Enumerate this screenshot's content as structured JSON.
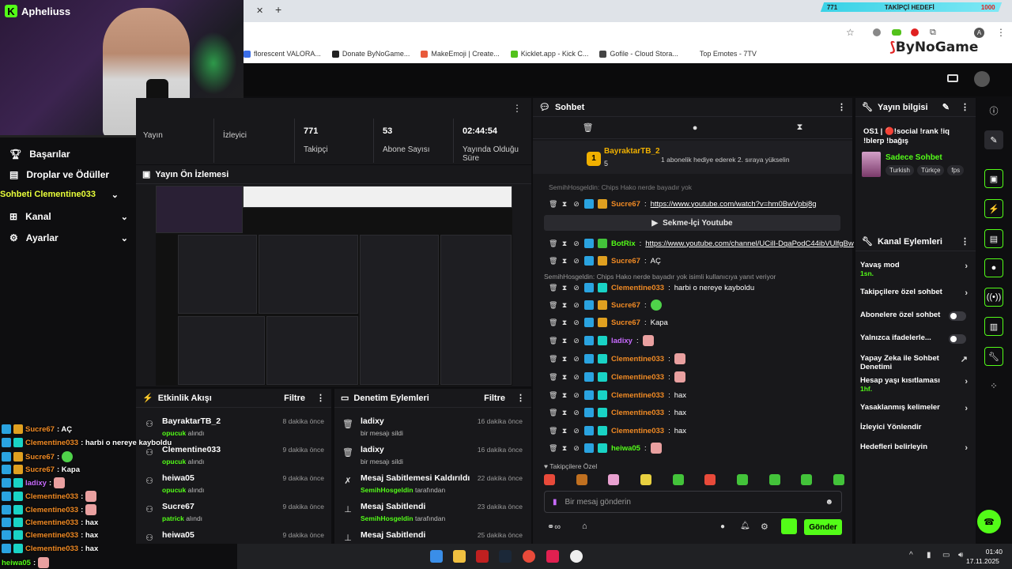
{
  "browser": {
    "close_tab": "✕",
    "new_tab": "+",
    "bookmarks": [
      {
        "label": "florescent VALORA...",
        "color": "#3b6ee8"
      },
      {
        "label": "Donate ByNoGame...",
        "color": "#222222"
      },
      {
        "label": "MakeEmoji | Create...",
        "color": "#e85a3b"
      },
      {
        "label": "Kicklet.app - Kick C...",
        "color": "#53c21b"
      },
      {
        "label": "Gofile - Cloud Stora...",
        "color": "#444444"
      },
      {
        "label": "Top Emotes - 7TV",
        "color": "#ffffff"
      }
    ]
  },
  "goal": {
    "count": "771",
    "label": "TAKİPÇİ HEDEFİ",
    "target": "1000"
  },
  "brand": {
    "logo_left": "By",
    "logo_right": "NoGame"
  },
  "webcam": {
    "streamer": "Apheliuss"
  },
  "sidebar": {
    "overlay_text": "Sohbeti Clementine033",
    "items": [
      {
        "label": "Başarılar",
        "icon": "trophy-icon"
      },
      {
        "label": "Droplar ve Ödüller",
        "icon": "gift-icon"
      },
      {
        "label": "Kanal",
        "icon": "channel-icon"
      },
      {
        "label": "Ayarlar",
        "icon": "gear-icon"
      }
    ]
  },
  "stats": [
    {
      "value": "",
      "label": "Yayın"
    },
    {
      "value": "",
      "label": "İzleyici"
    },
    {
      "value": "771",
      "label": "Takipçi"
    },
    {
      "value": "53",
      "label": "Abone Sayısı"
    },
    {
      "value": "02:44:54",
      "label": "Yayında Olduğu Süre"
    }
  ],
  "preview": {
    "title": "Yayın Ön İzlemesi"
  },
  "activity": {
    "title": "Etkinlik Akışı",
    "filter": "Filtre",
    "rows": [
      {
        "name": "BayraktarTB_2",
        "highlight": "opucuk",
        "rest": " alındı",
        "time": "8 dakika önce"
      },
      {
        "name": "Clementine033",
        "highlight": "opucuk",
        "rest": " alındı",
        "time": "9 dakika önce"
      },
      {
        "name": "heiwa05",
        "highlight": "opucuk",
        "rest": " alındı",
        "time": "9 dakika önce"
      },
      {
        "name": "Sucre67",
        "highlight": "patrick",
        "rest": " alındı",
        "time": "9 dakika önce"
      },
      {
        "name": "heiwa05",
        "highlight": "",
        "rest": "",
        "time": "9 dakika önce"
      }
    ]
  },
  "moderation": {
    "title": "Denetim Eylemleri",
    "filter": "Filtre",
    "rows": [
      {
        "name": "ladixy",
        "highlight": "",
        "rest": "bir mesajı sildi",
        "time": "16 dakika önce"
      },
      {
        "name": "ladixy",
        "highlight": "",
        "rest": "bir mesajı sildi",
        "time": "16 dakika önce"
      },
      {
        "name": "Mesaj Sabitlemesi Kaldırıldı",
        "highlight": "SemihHosgeldin",
        "rest": " tarafından",
        "time": "22 dakika önce"
      },
      {
        "name": "Mesaj Sabitlendi",
        "highlight": "SemihHosgeldin",
        "rest": " tarafından",
        "time": "23 dakika önce"
      },
      {
        "name": "Mesaj Sabitlendi",
        "highlight": "",
        "rest": "",
        "time": "25 dakika önce"
      }
    ]
  },
  "chat": {
    "title": "Sohbet",
    "pinned_user": "BayraktarTB_2",
    "pinned_rank": "1",
    "pinned_count": "5",
    "pinned_text": "1 abonelik hediye ederek 2. sıraya yükselin",
    "top_partial": "SemihHosgeldin: Chips Hako nerde bayadır yok",
    "youtube_label": "Sekme-İçi Youtube",
    "reply_context": "SemihHosgeldin: Chips Hako nerde bayadır yok isimli kullanıcıya yanıt veriyor",
    "messages": [
      {
        "user": "Sucre67",
        "color": "#f08a24",
        "text": "",
        "link": "https://www.youtube.com/watch?v=hm0BwVpbj8g",
        "emote": ""
      },
      {
        "user": "BotRix",
        "color": "#53fc18",
        "text": "",
        "link": "https://www.youtube.com/channel/UCilI-DqaPodC44ibVUlfgBw",
        "emote": ""
      },
      {
        "user": "Sucre67",
        "color": "#f08a24",
        "text": "AÇ",
        "link": "",
        "emote": ""
      },
      {
        "user": "Clementine033",
        "color": "#f08a24",
        "text": "harbi o nereye kayboldu",
        "link": "",
        "emote": ""
      },
      {
        "user": "Sucre67",
        "color": "#f08a24",
        "text": "",
        "link": "",
        "emote": "g"
      },
      {
        "user": "Sucre67",
        "color": "#f08a24",
        "text": "Kapa",
        "link": "",
        "emote": ""
      },
      {
        "user": "ladixy",
        "color": "#c86bff",
        "text": "",
        "link": "",
        "emote": "p"
      },
      {
        "user": "Clementine033",
        "color": "#f08a24",
        "text": "",
        "link": "",
        "emote": "p"
      },
      {
        "user": "Clementine033",
        "color": "#f08a24",
        "text": "",
        "link": "",
        "emote": "p"
      },
      {
        "user": "Clementine033",
        "color": "#f08a24",
        "text": "hax",
        "link": "",
        "emote": ""
      },
      {
        "user": "Clementine033",
        "color": "#f08a24",
        "text": "hax",
        "link": "",
        "emote": ""
      },
      {
        "user": "Clementine033",
        "color": "#f08a24",
        "text": "hax",
        "link": "",
        "emote": ""
      },
      {
        "user": "heiwa05",
        "color": "#53fc18",
        "text": "",
        "link": "",
        "emote": "p"
      }
    ],
    "followers_only": "Takipçilere Özel",
    "input_placeholder": "Bir mesaj gönderin",
    "send": "Gönder"
  },
  "stream_info": {
    "title": "Yayın bilgisi",
    "stream_title": "OS1 | 🔴!social !rank !iq !blerp !bağış",
    "category": "Sadece Sohbet",
    "tags": [
      "Turkish",
      "Türkçe",
      "fps"
    ]
  },
  "channel_actions": {
    "title": "Kanal Eylemleri",
    "rows": [
      {
        "label": "Yavaş mod",
        "sub": "1sn.",
        "control": "chevron"
      },
      {
        "label": "Takipçilere özel sohbet",
        "sub": "",
        "control": "chevron"
      },
      {
        "label": "Abonelere özel sohbet",
        "sub": "",
        "control": "toggle"
      },
      {
        "label": "Yalnızca ifadelerle...",
        "sub": "",
        "control": "toggle"
      },
      {
        "label": "Yapay Zeka ile Sohbet Denetimi",
        "sub": "",
        "control": "external"
      },
      {
        "label": "Hesap yaşı kısıtlaması",
        "sub": "1hf.",
        "control": "chevron"
      },
      {
        "label": "Yasaklanmış kelimeler",
        "sub": "",
        "control": "chevron"
      },
      {
        "label": "İzleyici Yönlendir",
        "sub": "",
        "control": "none"
      },
      {
        "label": "Hedefleri belirleyin",
        "sub": "",
        "control": "chevron"
      }
    ]
  },
  "overlay_chat": [
    {
      "user": "Sucre67",
      "color": "#f08a24",
      "text": ": AÇ"
    },
    {
      "user": "Clementine033",
      "color": "#f08a24",
      "text": ": harbi o nereye kayboldu"
    },
    {
      "user": "Sucre67",
      "color": "#f08a24",
      "text": ":"
    },
    {
      "user": "Sucre67",
      "color": "#f08a24",
      "text": ": Kapa"
    },
    {
      "user": "ladixy",
      "color": "#c86bff",
      "text": ":"
    },
    {
      "user": "Clementine033",
      "color": "#f08a24",
      "text": ":"
    },
    {
      "user": "Clementine033",
      "color": "#f08a24",
      "text": ":"
    },
    {
      "user": "Clementine033",
      "color": "#f08a24",
      "text": ": hax"
    },
    {
      "user": "Clementine033",
      "color": "#f08a24",
      "text": ": hax"
    },
    {
      "user": "Clementine033",
      "color": "#f08a24",
      "text": ": hax"
    },
    {
      "user": "heiwa05",
      "color": "#53fc18",
      "text": ":"
    }
  ],
  "taskbar": {
    "time": "01:40",
    "date": "17.11.2025"
  },
  "colors": {
    "accent": "#53fc18",
    "panel": "#18181b",
    "bg": "#0e0e10"
  }
}
